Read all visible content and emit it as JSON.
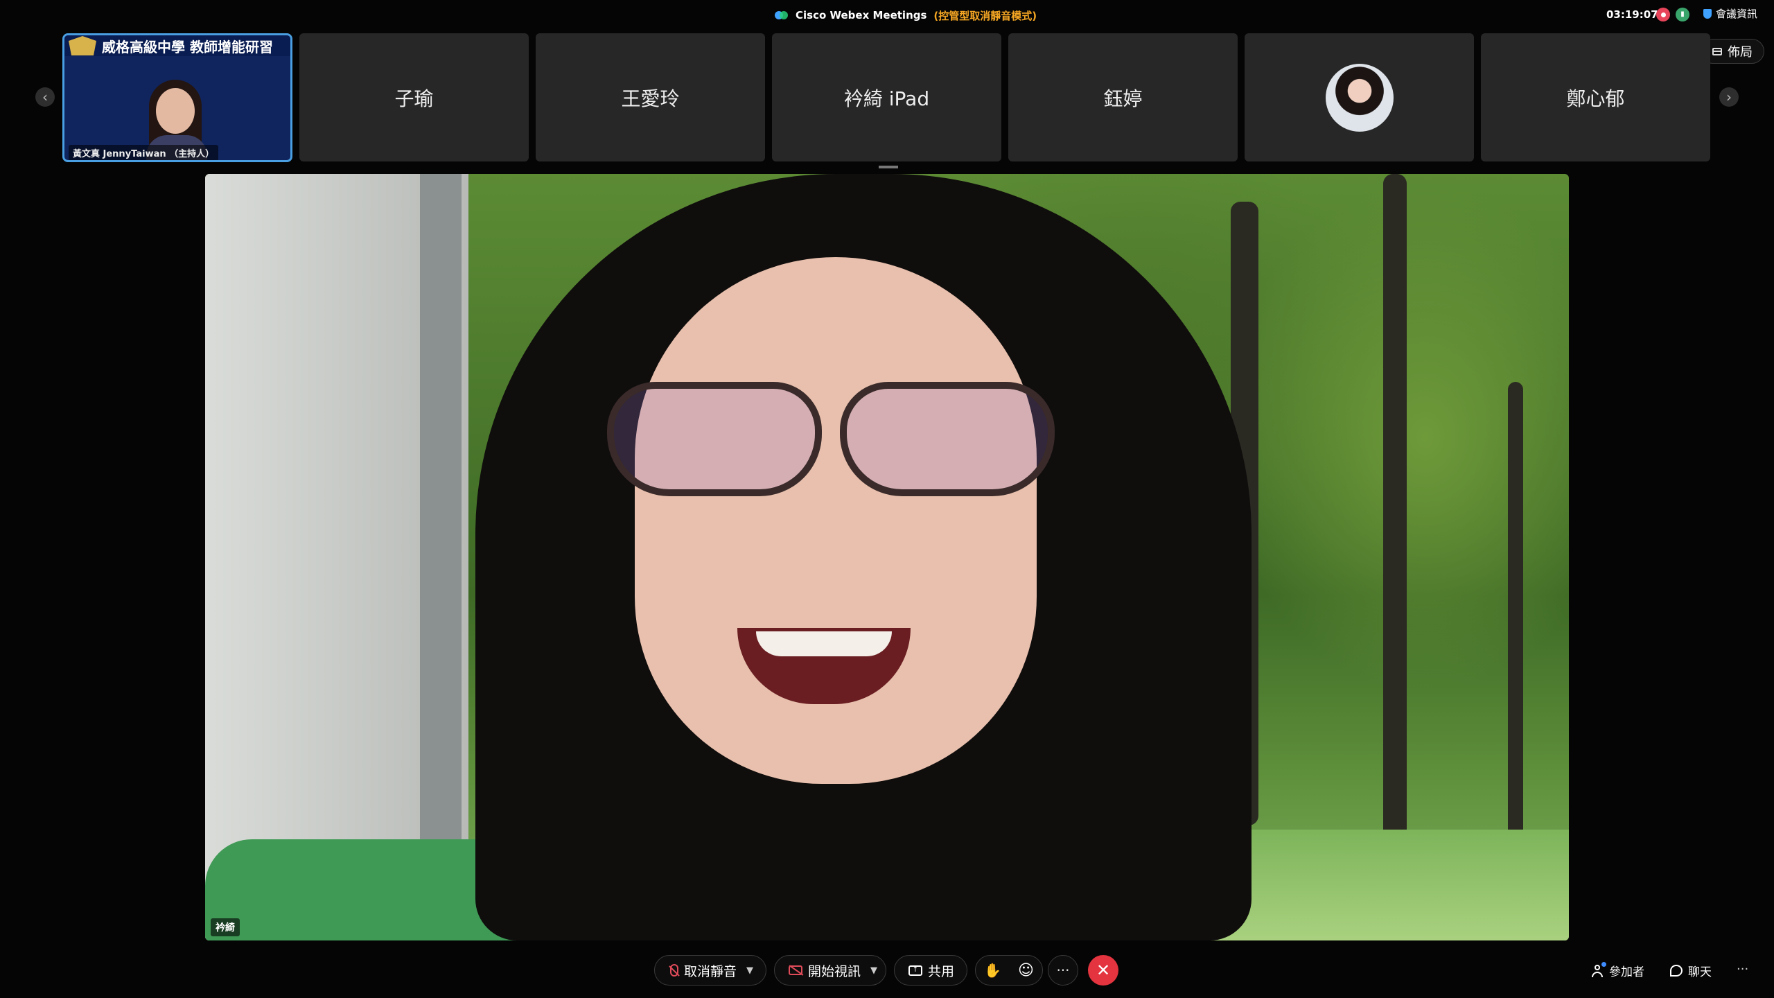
{
  "titlebar": {
    "app_name": "Cisco Webex Meetings",
    "mode": "(控管型取消靜音模式)",
    "clock": "03:19:07",
    "meeting_info": "會議資訊",
    "layout_button": "佈局"
  },
  "filmstrip": {
    "host": {
      "banner": "威格高級中學  教師增能研習",
      "name": "黃文真 JennyTaiwan （主持人）"
    },
    "participants": [
      "子瑜",
      "王愛玲",
      "衿綺 iPad",
      "鈺婷",
      "",
      "鄭心郁"
    ]
  },
  "main_video": {
    "speaker_name": "衿綺"
  },
  "controls": {
    "mute_label": "取消靜音",
    "video_label": "開始視訊",
    "share_label": "共用",
    "more_label": "···",
    "participants_label": "參加者",
    "chat_label": "聊天",
    "overflow_label": "···"
  },
  "colors": {
    "accent_blue": "#4a9fe3",
    "end_call_red": "#e3343f",
    "mode_orange": "#f5a623",
    "muted_red": "#e04b5a"
  }
}
